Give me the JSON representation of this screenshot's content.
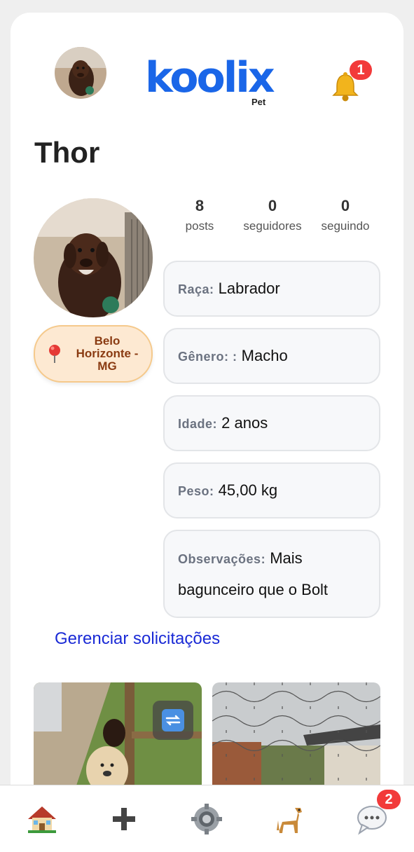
{
  "header": {
    "logo_text": "koolix",
    "logo_sub": "Pet",
    "notification_count": "1"
  },
  "profile": {
    "name": "Thor",
    "location": "Belo Horizonte - MG",
    "stats": [
      {
        "value": "8",
        "label": "posts"
      },
      {
        "value": "0",
        "label": "seguidores"
      },
      {
        "value": "0",
        "label": "seguindo"
      }
    ],
    "info": [
      {
        "label": "Raça:",
        "value": "Labrador"
      },
      {
        "label": "Gênero: :",
        "value": "Macho"
      },
      {
        "label": "Idade:",
        "value": "2 anos"
      },
      {
        "label": "Peso:",
        "value": "45,00 kg"
      },
      {
        "label": "Observações:",
        "value": "Mais bagunceiro que o Bolt"
      }
    ],
    "manage_link": "Gerenciar solicitações"
  },
  "nav": {
    "items": [
      "home-icon",
      "add-icon",
      "settings-icon",
      "pet-icon",
      "chat-icon"
    ],
    "message_count": "2"
  },
  "colors": {
    "brand": "#1a66e8",
    "badge": "#f23a3a",
    "link": "#1a2ad6",
    "location_bg": "#fde9d2"
  }
}
